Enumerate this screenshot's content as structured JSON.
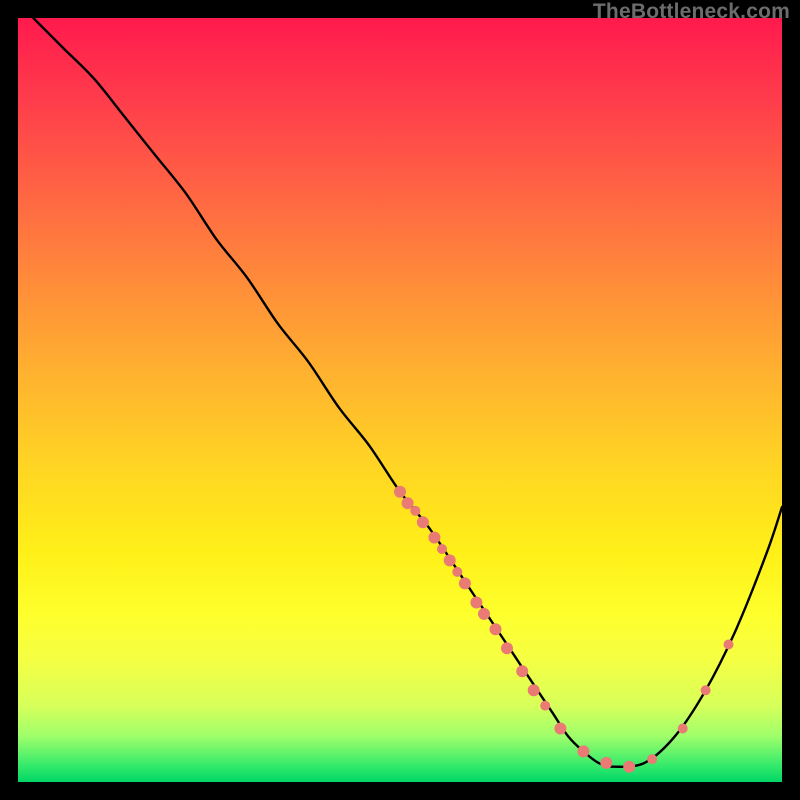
{
  "watermark": "TheBottleneck.com",
  "chart_data": {
    "type": "line",
    "title": "",
    "xlabel": "",
    "ylabel": "",
    "xlim": [
      0,
      100
    ],
    "ylim": [
      0,
      100
    ],
    "grid": false,
    "legend": false,
    "series": [
      {
        "name": "bottleneck-curve",
        "x": [
          2,
          6,
          10,
          14,
          18,
          22,
          26,
          30,
          34,
          38,
          42,
          46,
          50,
          54,
          58,
          62,
          64,
          66,
          68,
          70,
          72,
          74,
          76,
          78,
          82,
          86,
          90,
          94,
          98,
          100
        ],
        "y": [
          100,
          96,
          92,
          87,
          82,
          77,
          71,
          66,
          60,
          55,
          49,
          44,
          38,
          33,
          27,
          21,
          18,
          15,
          12,
          9,
          6,
          4,
          2.5,
          2,
          2.5,
          6,
          12,
          20,
          30,
          36
        ]
      }
    ],
    "scatter_points": {
      "name": "highlighted-data-points",
      "color": "#e97a74",
      "points": [
        {
          "x": 50,
          "y": 38,
          "r": 6
        },
        {
          "x": 51,
          "y": 36.5,
          "r": 6
        },
        {
          "x": 52,
          "y": 35.5,
          "r": 5
        },
        {
          "x": 53,
          "y": 34,
          "r": 6
        },
        {
          "x": 54.5,
          "y": 32,
          "r": 6
        },
        {
          "x": 55.5,
          "y": 30.5,
          "r": 5
        },
        {
          "x": 56.5,
          "y": 29,
          "r": 6
        },
        {
          "x": 57.5,
          "y": 27.5,
          "r": 5
        },
        {
          "x": 58.5,
          "y": 26,
          "r": 6
        },
        {
          "x": 60,
          "y": 23.5,
          "r": 6
        },
        {
          "x": 61,
          "y": 22,
          "r": 6
        },
        {
          "x": 62.5,
          "y": 20,
          "r": 6
        },
        {
          "x": 64,
          "y": 17.5,
          "r": 6
        },
        {
          "x": 66,
          "y": 14.5,
          "r": 6
        },
        {
          "x": 67.5,
          "y": 12,
          "r": 6
        },
        {
          "x": 69,
          "y": 10,
          "r": 5
        },
        {
          "x": 71,
          "y": 7,
          "r": 6
        },
        {
          "x": 74,
          "y": 4,
          "r": 6
        },
        {
          "x": 77,
          "y": 2.5,
          "r": 6
        },
        {
          "x": 80,
          "y": 2,
          "r": 6
        },
        {
          "x": 83,
          "y": 3,
          "r": 5
        },
        {
          "x": 87,
          "y": 7,
          "r": 5
        },
        {
          "x": 90,
          "y": 12,
          "r": 5
        },
        {
          "x": 93,
          "y": 18,
          "r": 5
        }
      ]
    }
  }
}
